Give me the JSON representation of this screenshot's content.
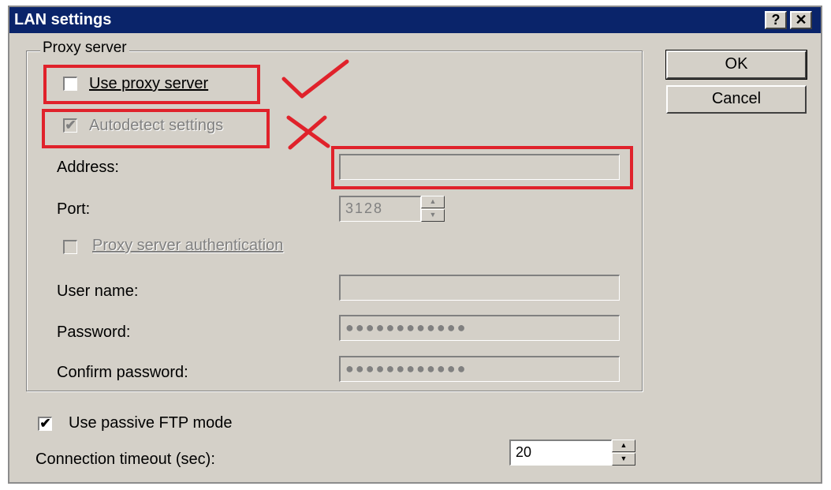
{
  "window": {
    "title": "LAN settings",
    "help_glyph": "?",
    "close_glyph": "✕"
  },
  "proxy": {
    "group_label": "Proxy server",
    "use_proxy_label": "Use proxy server",
    "use_proxy_checked": false,
    "autodetect_label": "Autodetect settings",
    "autodetect_checked": true,
    "address_label": "Address:",
    "address_value": "",
    "port_label": "Port:",
    "port_value": "3128",
    "auth_label": "Proxy server authentication",
    "auth_checked": false,
    "username_label": "User name:",
    "username_value": "",
    "password_label": "Password:",
    "password_value": "●●●●●●●●●●●●",
    "confirm_label": "Confirm password:",
    "confirm_value": "●●●●●●●●●●●●"
  },
  "passive_ftp": {
    "label": "Use passive FTP mode",
    "checked": true
  },
  "timeout": {
    "label": "Connection timeout (sec):",
    "value": "20"
  },
  "buttons": {
    "ok": "OK",
    "cancel": "Cancel"
  },
  "checkmark_glyph": "✔",
  "annotation_colors": {
    "highlight": "#e0222b"
  }
}
